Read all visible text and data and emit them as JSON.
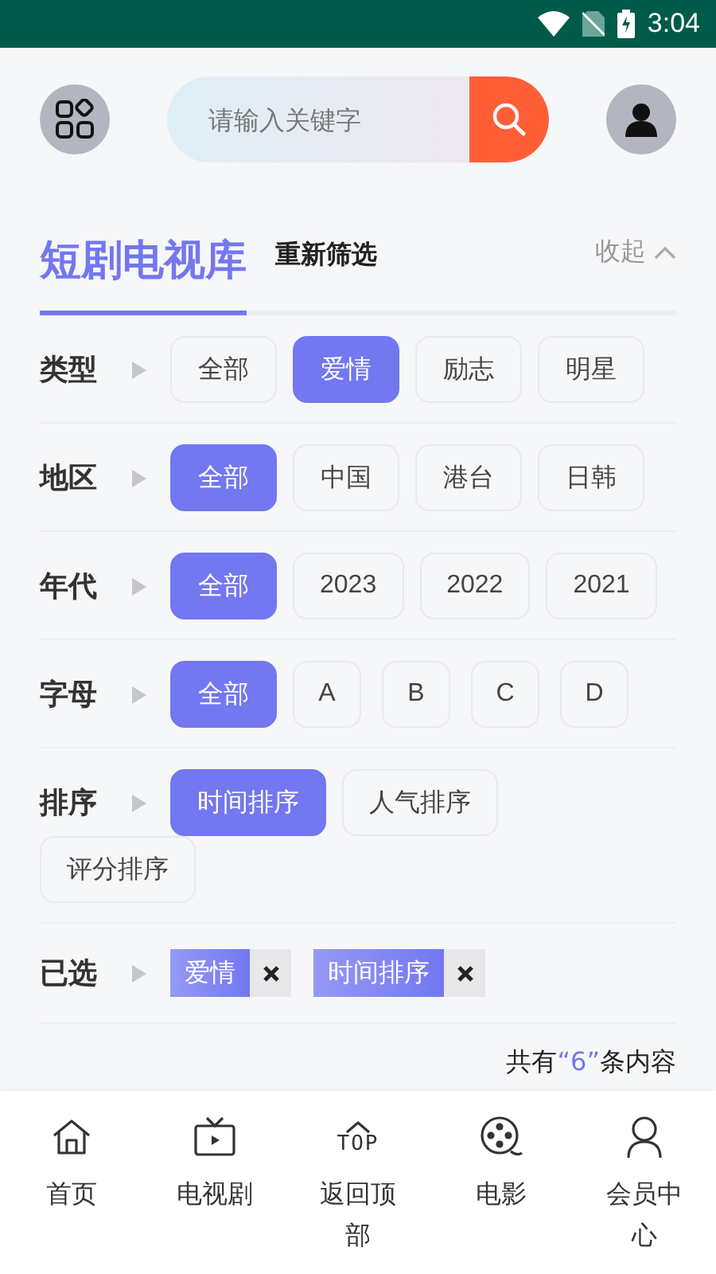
{
  "status_bar": {
    "time": "3:04"
  },
  "search": {
    "placeholder": "请输入关键字"
  },
  "header": {
    "title": "短剧电视库",
    "reset": "重新筛选",
    "collapse": "收起"
  },
  "filters": [
    {
      "label": "类型",
      "options": [
        {
          "text": "全部",
          "selected": false
        },
        {
          "text": "爱情",
          "selected": true
        },
        {
          "text": "励志",
          "selected": false
        },
        {
          "text": "明星",
          "selected": false
        }
      ]
    },
    {
      "label": "地区",
      "options": [
        {
          "text": "全部",
          "selected": true
        },
        {
          "text": "中国",
          "selected": false
        },
        {
          "text": "港台",
          "selected": false
        },
        {
          "text": "日韩",
          "selected": false
        }
      ]
    },
    {
      "label": "年代",
      "options": [
        {
          "text": "全部",
          "selected": true
        },
        {
          "text": "2023",
          "selected": false
        },
        {
          "text": "2022",
          "selected": false
        },
        {
          "text": "2021",
          "selected": false
        }
      ]
    },
    {
      "label": "字母",
      "options": [
        {
          "text": "全部",
          "selected": true
        },
        {
          "text": "A",
          "selected": false
        },
        {
          "text": "B",
          "selected": false
        },
        {
          "text": "C",
          "selected": false
        },
        {
          "text": "D",
          "selected": false
        }
      ]
    },
    {
      "label": "排序",
      "options": [
        {
          "text": "时间排序",
          "selected": true
        },
        {
          "text": "人气排序",
          "selected": false
        },
        {
          "text": "评分排序",
          "selected": false
        }
      ]
    }
  ],
  "selected_filters": {
    "label": "已选",
    "tags": [
      {
        "text": "爱情"
      },
      {
        "text": "时间排序"
      }
    ]
  },
  "result": {
    "prefix": "共有",
    "count": "“6”",
    "suffix": "条内容"
  },
  "nav": [
    {
      "label": "首页",
      "kind": "home"
    },
    {
      "label": "电视剧",
      "kind": "tv"
    },
    {
      "label": "返回顶部",
      "kind": "top",
      "icon_text": "TOP"
    },
    {
      "label": "电影",
      "kind": "film"
    },
    {
      "label": "会员中心",
      "kind": "user"
    }
  ]
}
